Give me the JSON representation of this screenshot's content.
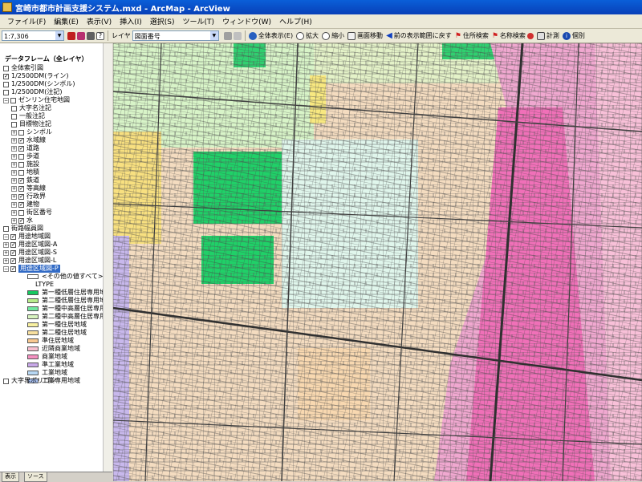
{
  "window": {
    "title": "宮崎市都市計画支援システム.mxd - ArcMap - ArcView"
  },
  "menu": [
    "ファイル(F)",
    "編集(E)",
    "表示(V)",
    "挿入(I)",
    "選択(S)",
    "ツール(T)",
    "ウィンドウ(W)",
    "ヘルプ(H)"
  ],
  "toolbar": {
    "scale": "1:7,306",
    "layer_label": "レイヤ",
    "layer_value": "図面番号",
    "full_extent": "全体表示(E)",
    "zoom_in": "拡大",
    "zoom_out": "縮小",
    "pan": "画面移動",
    "previous_extent": "前の表示範囲に戻す",
    "address_search": "住所検索",
    "name_search": "名称検索",
    "measure": "計測",
    "identify": "個別"
  },
  "toc": {
    "dataframe": "データフレーム（全レイヤ）",
    "layers": [
      {
        "label": "全体索引図",
        "checked": false,
        "indent": 1
      },
      {
        "label": "1/2500DM(ライン)",
        "checked": true,
        "indent": 1
      },
      {
        "label": "1/2500DM(シンボル)",
        "checked": false,
        "indent": 1
      },
      {
        "label": "1/2500DM(注記)",
        "checked": false,
        "indent": 1
      },
      {
        "label": "ゼンリン住宅地図",
        "checked": false,
        "indent": 1,
        "expander": "−"
      },
      {
        "label": "大字名注記",
        "checked": false,
        "indent": 2
      },
      {
        "label": "一般注記",
        "checked": false,
        "indent": 2
      },
      {
        "label": "目標物注記",
        "checked": false,
        "indent": 2
      },
      {
        "label": "シンボル",
        "checked": false,
        "indent": 2,
        "expander": "+"
      },
      {
        "label": "水域線",
        "checked": true,
        "indent": 2,
        "expander": "+"
      },
      {
        "label": "道路",
        "checked": true,
        "indent": 2,
        "expander": "+"
      },
      {
        "label": "歩道",
        "checked": false,
        "indent": 2,
        "expander": "+"
      },
      {
        "label": "施設",
        "checked": false,
        "indent": 2,
        "expander": "+"
      },
      {
        "label": "地積",
        "checked": false,
        "indent": 2,
        "expander": "+"
      },
      {
        "label": "鉄道",
        "checked": true,
        "indent": 2,
        "expander": "+"
      },
      {
        "label": "等高線",
        "checked": true,
        "indent": 2,
        "expander": "+"
      },
      {
        "label": "行政界",
        "checked": true,
        "indent": 2,
        "expander": "+"
      },
      {
        "label": "建物",
        "checked": true,
        "indent": 2,
        "expander": "+"
      },
      {
        "label": "街区番号",
        "checked": false,
        "indent": 2,
        "expander": "+"
      },
      {
        "label": "水",
        "checked": true,
        "indent": 2,
        "expander": "+"
      },
      {
        "label": "街路幅員図",
        "checked": false,
        "indent": 1
      },
      {
        "label": "用途地域図",
        "checked": true,
        "indent": 1,
        "expander": "−"
      },
      {
        "label": "用途区域図-A",
        "checked": true,
        "indent": 1,
        "expander": "+"
      },
      {
        "label": "用途区域図-S",
        "checked": true,
        "indent": 1,
        "expander": "+"
      },
      {
        "label": "用途区域図-L",
        "checked": true,
        "indent": 1,
        "expander": "+"
      },
      {
        "label": "用途区域図-P",
        "checked": true,
        "indent": 1,
        "expander": "−",
        "selected": true
      }
    ],
    "other_values": "<その他の値すべて>",
    "field": "LTYPE",
    "legend": [
      {
        "label": "第一種低層住居専用地域",
        "color": "#16c860"
      },
      {
        "label": "第二種低層住居専用地域",
        "color": "#b8ec8c"
      },
      {
        "label": "第一種中高層住居専用地域",
        "color": "#70e8a0"
      },
      {
        "label": "第二種中高層住居専用地域",
        "color": "#d8f4c0"
      },
      {
        "label": "第一種住居地域",
        "color": "#f8f0a0"
      },
      {
        "label": "第二種住居地域",
        "color": "#f8e0a0"
      },
      {
        "label": "準住居地域",
        "color": "#f8c890"
      },
      {
        "label": "近隣商業地域",
        "color": "#f8c0d0"
      },
      {
        "label": "商業地域",
        "color": "#f490c0"
      },
      {
        "label": "準工業地域",
        "color": "#c8a8e8"
      },
      {
        "label": "工業地域",
        "color": "#b8d8f4"
      },
      {
        "label": "工業専用地域",
        "color": "#a8c0f0"
      }
    ],
    "last_layer": "大字界ポリゴン"
  },
  "tabs": {
    "display": "表示",
    "source": "ソース"
  }
}
